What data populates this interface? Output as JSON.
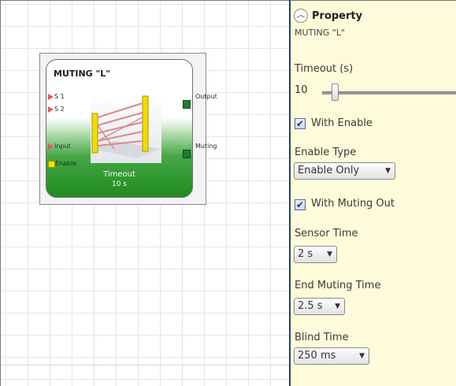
{
  "block": {
    "title": "MUTING \"L\"",
    "inputs": [
      "S 1",
      "S 2",
      "Input",
      "Enable"
    ],
    "outputs": [
      "Output",
      "Muting"
    ],
    "footer_label": "Timeout",
    "footer_value": "10 s"
  },
  "panel": {
    "title": "Property",
    "subtitle": "MUTING \"L\"",
    "timeout_label": "Timeout (s)",
    "timeout_value": "10",
    "with_enable": {
      "label": "With Enable",
      "checked": true
    },
    "enable_type": {
      "label": "Enable Type",
      "value": "Enable Only"
    },
    "with_muting_out": {
      "label": "With Muting Out",
      "checked": true
    },
    "sensor_time": {
      "label": "Sensor Time",
      "value": "2 s"
    },
    "end_muting_time": {
      "label": "End Muting Time",
      "value": "2.5 s"
    },
    "blind_time": {
      "label": "Blind Time",
      "value": "250 ms"
    }
  },
  "icons": {
    "collapse": "chevron-up-icon",
    "dropdown": "chevron-down-icon",
    "block_picture": "light-curtain-icon"
  },
  "colors": {
    "panel_bg": "#fdfbd9",
    "block_green": "#1f8a1f",
    "input_pin": "#e05a5a",
    "output_pin": "#1f7a36",
    "enable_pin": "#f2e200"
  }
}
